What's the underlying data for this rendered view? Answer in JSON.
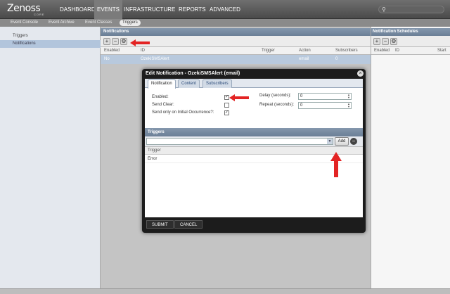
{
  "topnav": {
    "logo": "Zenoss",
    "logo_sub": "CORE",
    "tabs": [
      {
        "label": "DASHBOARD"
      },
      {
        "label": "EVENTS"
      },
      {
        "label": "INFRASTRUCTURE"
      },
      {
        "label": "REPORTS"
      },
      {
        "label": "ADVANCED"
      }
    ],
    "active_tab": "EVENTS",
    "search_icon": "search-icon"
  },
  "subnav": {
    "tabs": [
      {
        "label": "Event Console"
      },
      {
        "label": "Event Archive"
      },
      {
        "label": "Event Classes"
      },
      {
        "label": "Triggers"
      }
    ],
    "active_tab": "Triggers"
  },
  "left_panel": {
    "items": [
      {
        "label": "Triggers"
      },
      {
        "label": "Notifications"
      }
    ],
    "selected": "Notifications"
  },
  "notifications": {
    "title": "Notifications",
    "columns": [
      "Enabled",
      "ID",
      "Trigger",
      "Action",
      "Subscribers"
    ],
    "rows": [
      {
        "enabled": "No",
        "id": "OzekiSMSAlert",
        "trigger": "",
        "action": "email",
        "subscribers": "0"
      }
    ]
  },
  "schedules": {
    "title": "Notification Schedules",
    "columns": [
      "Enabled",
      "ID",
      "Start"
    ]
  },
  "dialog": {
    "title": "Edit Notification - OzekiSMSAlert (email)",
    "tabs": [
      {
        "label": "Notification"
      },
      {
        "label": "Content"
      },
      {
        "label": "Subscribers"
      }
    ],
    "active_tab": "Notification",
    "enabled_label": "Enabled:",
    "enabled_checked": true,
    "send_clear_label": "Send Clear:",
    "send_clear_checked": false,
    "initial_only_label": "Send only on Initial Occurrence?:",
    "initial_only_checked": true,
    "delay_label": "Delay (seconds):",
    "delay_value": "0",
    "repeat_label": "Repeat (seconds):",
    "repeat_value": "0",
    "triggers_title": "Triggers",
    "trigger_combo_value": "",
    "add_label": "Add",
    "trigger_column": "Trigger",
    "trigger_rows": [
      "Error"
    ],
    "submit_label": "SUBMIT",
    "cancel_label": "CANCEL"
  },
  "colors": {
    "annotation": "#e32424",
    "panel_header": "#7a8ca3",
    "selection": "#b8c9dd"
  }
}
